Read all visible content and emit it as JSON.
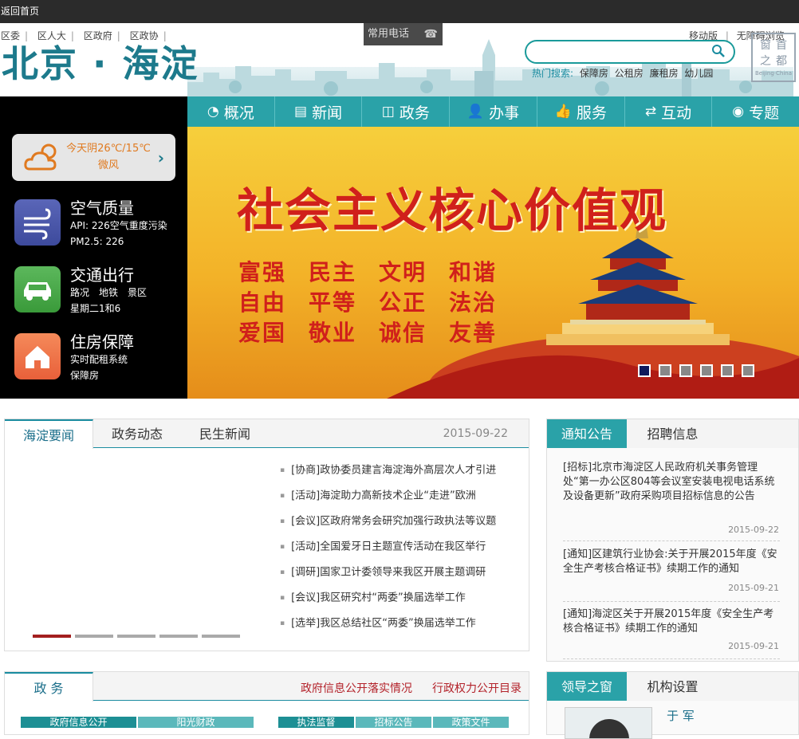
{
  "topbar": {
    "back_label": "返回首页"
  },
  "header": {
    "toplinks": [
      "区委",
      "区人大",
      "区政府",
      "区政协"
    ],
    "logo": "北京 · 海淀",
    "phone_label": "常用电话",
    "mobile_label": "移动版",
    "accessible_label": "无障碍浏览",
    "search_placeholder": "",
    "hot_label": "热门搜索:",
    "hot_terms": [
      "保障房",
      "公租房",
      "廉租房",
      "幼儿园"
    ],
    "capital_lines": [
      "首",
      "都",
      "之",
      "窗"
    ],
    "capital_sub": "Beijing·China"
  },
  "nav": [
    {
      "label": "概况",
      "icon": "pie-chart-icon",
      "glyph": "◔"
    },
    {
      "label": "新闻",
      "icon": "document-icon",
      "glyph": "▤"
    },
    {
      "label": "政务",
      "icon": "book-icon",
      "glyph": "◫"
    },
    {
      "label": "办事",
      "icon": "person-icon",
      "glyph": "👤"
    },
    {
      "label": "服务",
      "icon": "thumbs-up-icon",
      "glyph": "👍"
    },
    {
      "label": "互动",
      "icon": "exchange-icon",
      "glyph": "⇄"
    },
    {
      "label": "专题",
      "icon": "target-icon",
      "glyph": "◉"
    }
  ],
  "sidebar": {
    "weather_line1": "今天阴26℃/15℃",
    "weather_line2": "微风",
    "air": {
      "title": "空气质量",
      "line1": "API: 226空气重度污染",
      "line2": "PM2.5: 226"
    },
    "traffic": {
      "title": "交通出行",
      "line1": "路况　地铁　景区",
      "line2": "星期二1和6"
    },
    "housing": {
      "title": "住房保障",
      "line1": "实时配租系统",
      "line2": "保障房"
    }
  },
  "banner": {
    "slogan": "社会主义核心价值观",
    "values": [
      [
        "富强",
        "民主",
        "文明",
        "和谐"
      ],
      [
        "自由",
        "平等",
        "公正",
        "法治"
      ],
      [
        "爱国",
        "敬业",
        "诚信",
        "友善"
      ]
    ],
    "active_slide": 0,
    "slide_count": 6
  },
  "news_panel": {
    "tabs": [
      "海淀要闻",
      "政务动态",
      "民生新闻"
    ],
    "date": "2015-09-22",
    "items": [
      "[协商]政协委员建言海淀海外高层次人才引进",
      "[活动]海淀助力高新技术企业“走进”欧洲",
      "[会议]区政府常务会研究加强行政执法等议题",
      "[活动]全国爱牙日主题宣传活动在我区举行",
      "[调研]国家卫计委领导来我区开展主题调研",
      "[会议]我区研究村“两委”换届选举工作",
      "[选举]我区总结社区“两委”换届选举工作"
    ],
    "active_bar": 0,
    "bar_count": 5
  },
  "notice_panel": {
    "tabs": [
      "通知公告",
      "招聘信息"
    ],
    "items": [
      {
        "text": "[招标]北京市海淀区人民政府机关事务管理处“第一办公区804等会议室安装电视电话系统及设备更新”政府采购项目招标信息的公告",
        "date": "2015-09-22"
      },
      {
        "text": "[通知]区建筑行业协会:关于开展2015年度《安全生产考核合格证书》续期工作的通知",
        "date": "2015-09-21"
      },
      {
        "text": "[通知]海淀区关于开展2015年度《安全生产考核合格证书》续期工作的通知",
        "date": "2015-09-21"
      }
    ]
  },
  "gov_panel": {
    "tab": "政 务",
    "link1": "政府信息公开落实情况",
    "link2": "行政权力公开目录",
    "subtabs_left": [
      "政府信息公开",
      "阳光财政"
    ],
    "subtabs_right": [
      "执法监督",
      "招标公告",
      "政策文件"
    ]
  },
  "leader_panel": {
    "tabs": [
      "领导之窗",
      "机构设置"
    ],
    "name": "于 军"
  }
}
